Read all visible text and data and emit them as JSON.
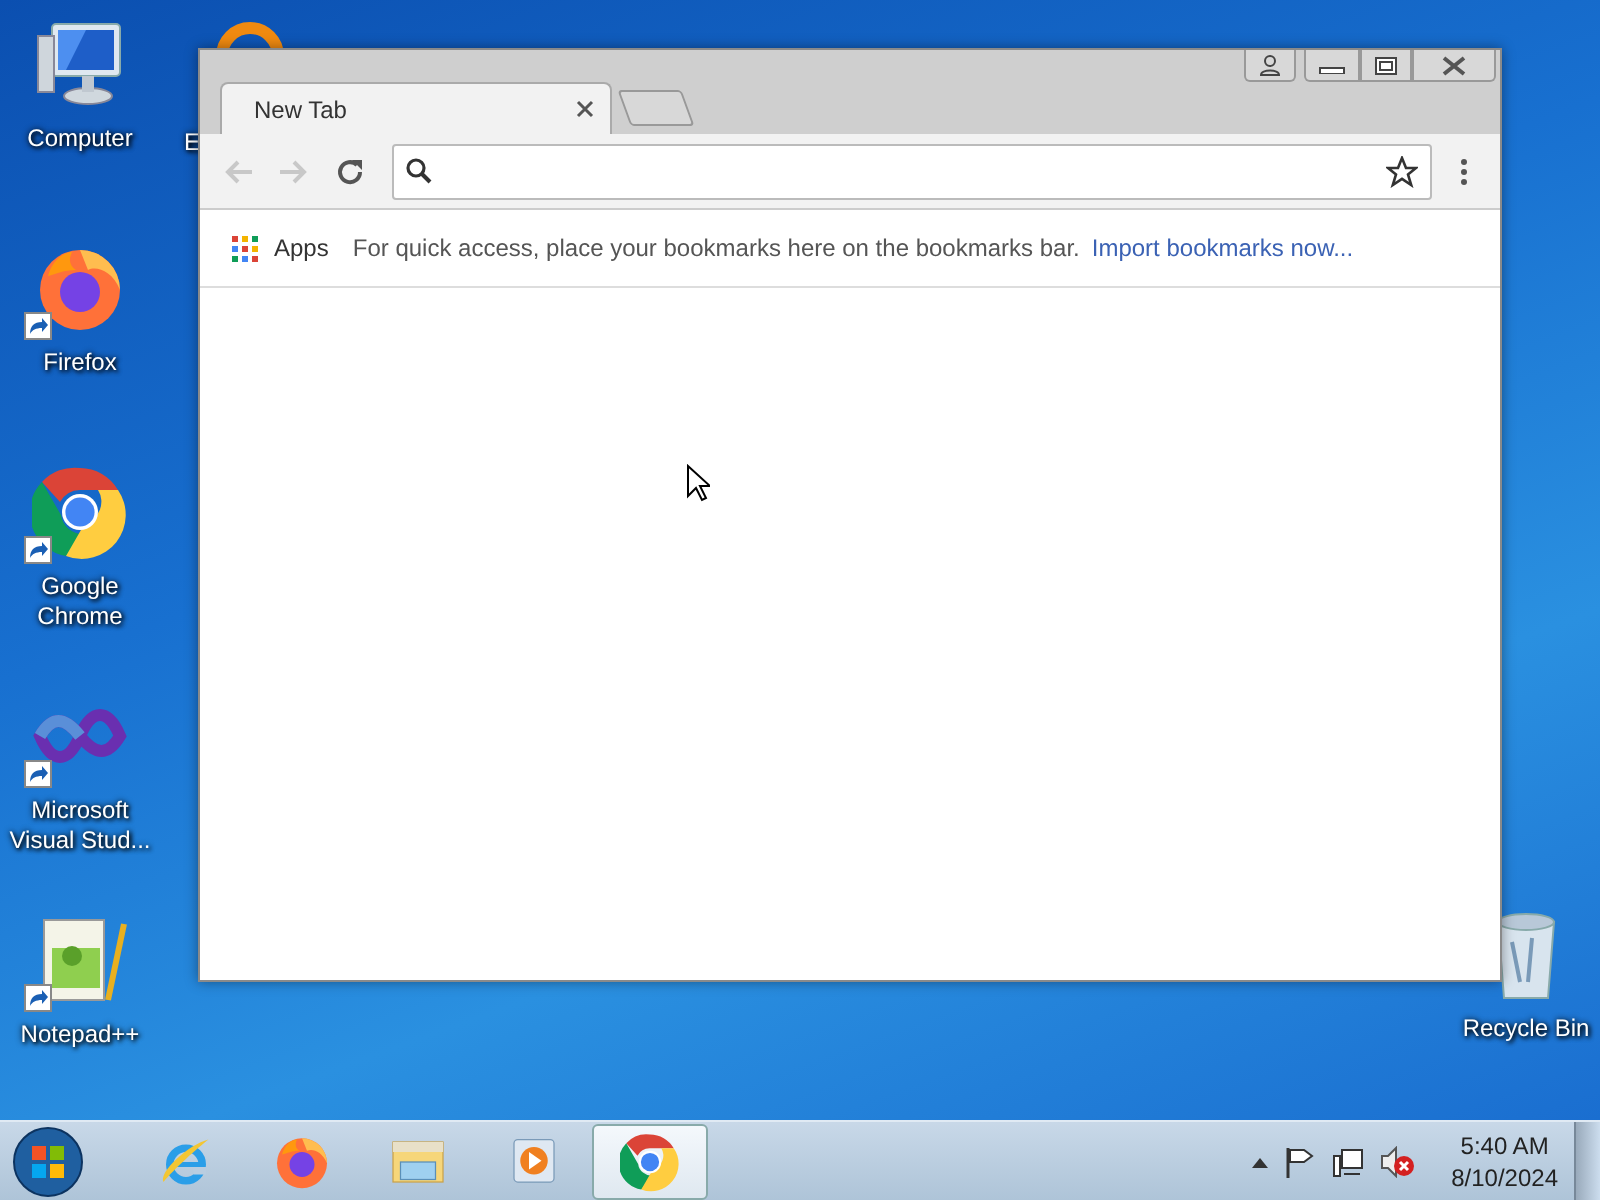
{
  "desktop_icons": [
    {
      "label": "Computer",
      "kind": "computer",
      "shortcut": false
    },
    {
      "label": "Firefox",
      "kind": "firefox",
      "shortcut": true
    },
    {
      "label": "Google Chrome",
      "kind": "chrome",
      "shortcut": true
    },
    {
      "label": "Microsoft Visual Stud...",
      "kind": "vs",
      "shortcut": true
    },
    {
      "label": "Notepad++",
      "kind": "notepad",
      "shortcut": true
    }
  ],
  "hidden_icon": {
    "label": "E"
  },
  "recycle_bin": {
    "label": "Recycle Bin"
  },
  "browser": {
    "tabs": [
      {
        "label": "New Tab",
        "selected": true
      }
    ],
    "nav_buttons": [
      {
        "kind": "back",
        "disabled": true
      },
      {
        "kind": "forward",
        "disabled": true
      },
      {
        "kind": "reload",
        "disabled": false
      }
    ],
    "bookmarks_bar": {
      "apps": "Apps",
      "hint": "For quick access, place your bookmarks here on the bookmarks bar.",
      "link": "Import bookmarks now..."
    }
  },
  "taskbar": {
    "items": [
      {
        "kind": "ie",
        "selected": false
      },
      {
        "kind": "firefox",
        "selected": false
      },
      {
        "kind": "explorer",
        "selected": false
      },
      {
        "kind": "media",
        "selected": false
      },
      {
        "kind": "chrome",
        "selected": true
      }
    ],
    "clock": {
      "time": "5:40 AM",
      "date": "8/10/2024"
    }
  }
}
